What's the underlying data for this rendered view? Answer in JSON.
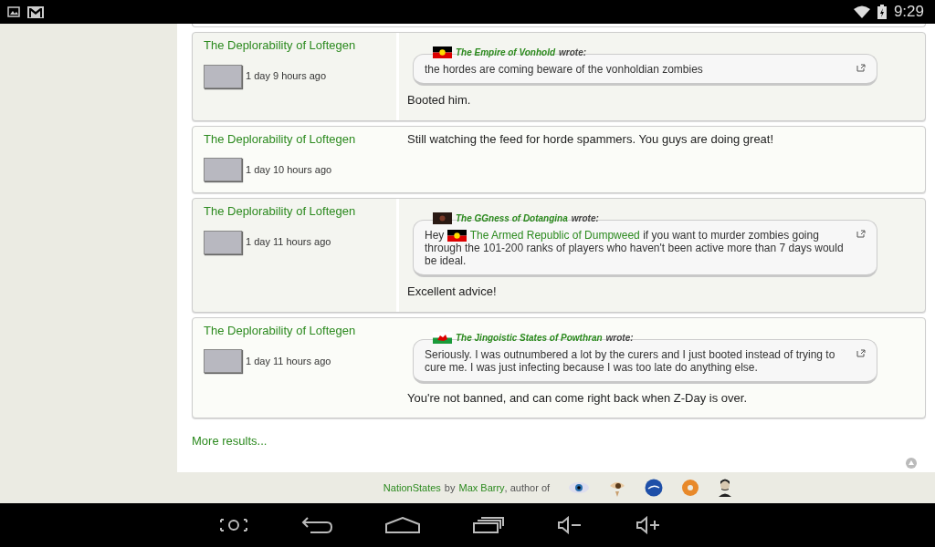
{
  "status_bar": {
    "time": "9:29"
  },
  "posts": [
    {
      "author": "The Deplorability of Loftegen",
      "time": "1 day 9 hours ago",
      "quote": {
        "flag": {
          "kind": "aboriginal"
        },
        "author": "The Empire of Vonhold",
        "wrote": "wrote:",
        "parts": [
          {
            "kind": "text",
            "text": "the hordes are coming beware of the vonholdian zombies"
          }
        ]
      },
      "body": "Booted him."
    },
    {
      "author": "The Deplorability of Loftegen",
      "time": "1 day 10 hours ago",
      "body": "Still watching the feed for horde spammers. You guys are doing great!"
    },
    {
      "author": "The Deplorability of Loftegen",
      "time": "1 day 11 hours ago",
      "quote": {
        "flag": {
          "kind": "dark"
        },
        "author": "The GGness of Dotangina",
        "wrote": "wrote:",
        "parts": [
          {
            "kind": "text",
            "text": "Hey"
          },
          {
            "kind": "flag",
            "flag": {
              "kind": "aboriginal"
            }
          },
          {
            "kind": "link",
            "text": "The Armed Republic of Dumpweed"
          },
          {
            "kind": "text",
            "text": "if you want to murder zombies going through the 101-200 ranks of players who haven't been active more than 7 days would be ideal."
          }
        ]
      },
      "body": "Excellent advice!"
    },
    {
      "author": "The Deplorability of Loftegen",
      "time": "1 day 11 hours ago",
      "quote": {
        "flag": {
          "kind": "wales"
        },
        "author": "The Jingoistic States of Powthran",
        "wrote": "wrote:",
        "parts": [
          {
            "kind": "text",
            "text": "Seriously. I was outnumbered a lot by the curers and I just booted instead of trying to cure me. I was just infecting because I was too late do anything else."
          }
        ]
      },
      "body": "You're not banned, and can come right back when Z-Day is over."
    }
  ],
  "more_results": "More results...",
  "footer": [
    {
      "kind": "link",
      "text": "NationStates"
    },
    {
      "kind": "text",
      "text": "by"
    },
    {
      "kind": "link",
      "text": "Max Barry"
    },
    {
      "kind": "text",
      "text": ", author of"
    }
  ]
}
